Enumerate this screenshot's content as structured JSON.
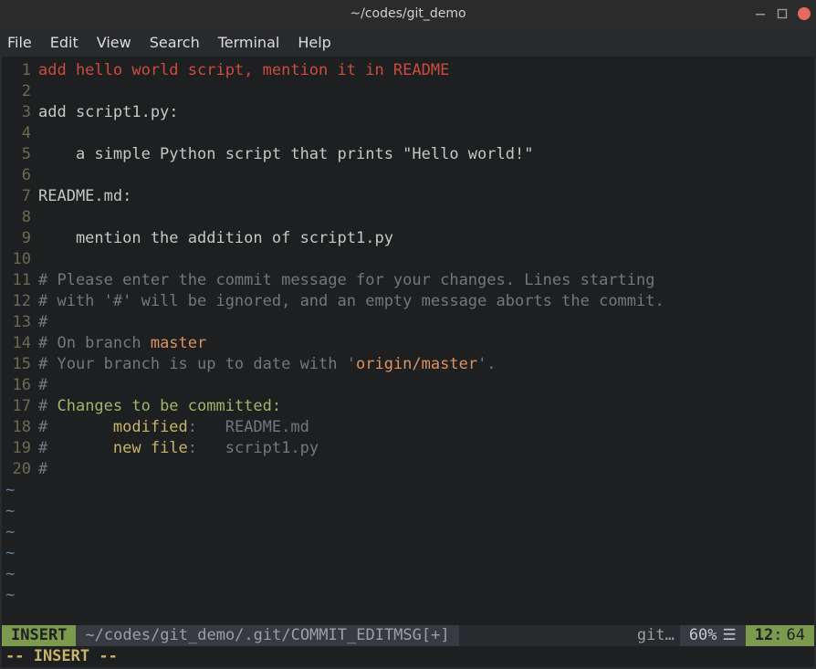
{
  "window": {
    "title": "~/codes/git_demo"
  },
  "menu": {
    "items": [
      "File",
      "Edit",
      "View",
      "Search",
      "Terminal",
      "Help"
    ]
  },
  "lines": [
    {
      "n": 1,
      "segs": [
        {
          "t": "add hello world script, mention it in README",
          "c": "c-red"
        }
      ]
    },
    {
      "n": 2,
      "segs": []
    },
    {
      "n": 3,
      "segs": [
        {
          "t": "add script1.py:",
          "c": "c-white"
        }
      ]
    },
    {
      "n": 4,
      "segs": []
    },
    {
      "n": 5,
      "segs": [
        {
          "t": "    a simple Python script that prints \"Hello world!\"",
          "c": "c-white"
        }
      ]
    },
    {
      "n": 6,
      "segs": []
    },
    {
      "n": 7,
      "segs": [
        {
          "t": "README.md:",
          "c": "c-white"
        }
      ]
    },
    {
      "n": 8,
      "segs": []
    },
    {
      "n": 9,
      "segs": [
        {
          "t": "    mention the addition of script1.py",
          "c": "c-white"
        }
      ]
    },
    {
      "n": 10,
      "segs": []
    },
    {
      "n": 11,
      "segs": [
        {
          "t": "# Please enter the commit message for your changes. Lines starting",
          "c": "c-gray"
        }
      ]
    },
    {
      "n": 12,
      "segs": [
        {
          "t": "# with '#' will be ignored, and an empty message aborts the commit.",
          "c": "c-gray"
        }
      ]
    },
    {
      "n": 13,
      "segs": [
        {
          "t": "#",
          "c": "c-gray"
        }
      ]
    },
    {
      "n": 14,
      "segs": [
        {
          "t": "# On branch ",
          "c": "c-gray"
        },
        {
          "t": "master",
          "c": "c-orange"
        }
      ]
    },
    {
      "n": 15,
      "segs": [
        {
          "t": "# Your branch is up to date with '",
          "c": "c-gray"
        },
        {
          "t": "origin/master",
          "c": "c-orange"
        },
        {
          "t": "'.",
          "c": "c-gray"
        }
      ]
    },
    {
      "n": 16,
      "segs": [
        {
          "t": "#",
          "c": "c-gray"
        }
      ]
    },
    {
      "n": 17,
      "segs": [
        {
          "t": "# ",
          "c": "c-gray"
        },
        {
          "t": "Changes to be committed:",
          "c": "c-green"
        }
      ]
    },
    {
      "n": 18,
      "segs": [
        {
          "t": "#       ",
          "c": "c-gray"
        },
        {
          "t": "modified",
          "c": "c-yellow"
        },
        {
          "t": ":   README.md",
          "c": "c-gray"
        }
      ]
    },
    {
      "n": 19,
      "segs": [
        {
          "t": "#       ",
          "c": "c-gray"
        },
        {
          "t": "new file",
          "c": "c-yellow"
        },
        {
          "t": ":   script1.py",
          "c": "c-gray"
        }
      ]
    },
    {
      "n": 20,
      "segs": [
        {
          "t": "#",
          "c": "c-gray"
        }
      ]
    }
  ],
  "tilde_rows": 6,
  "tilde_char": "~",
  "statusline": {
    "mode": "INSERT",
    "path": "~/codes/git_demo/.git/COMMIT_EDITMSG[+]",
    "git": "git…",
    "hamburger": "☰",
    "percent": "60%",
    "line": "12",
    "col_sep": ":",
    "col": "64"
  },
  "cmdline": "-- INSERT --"
}
